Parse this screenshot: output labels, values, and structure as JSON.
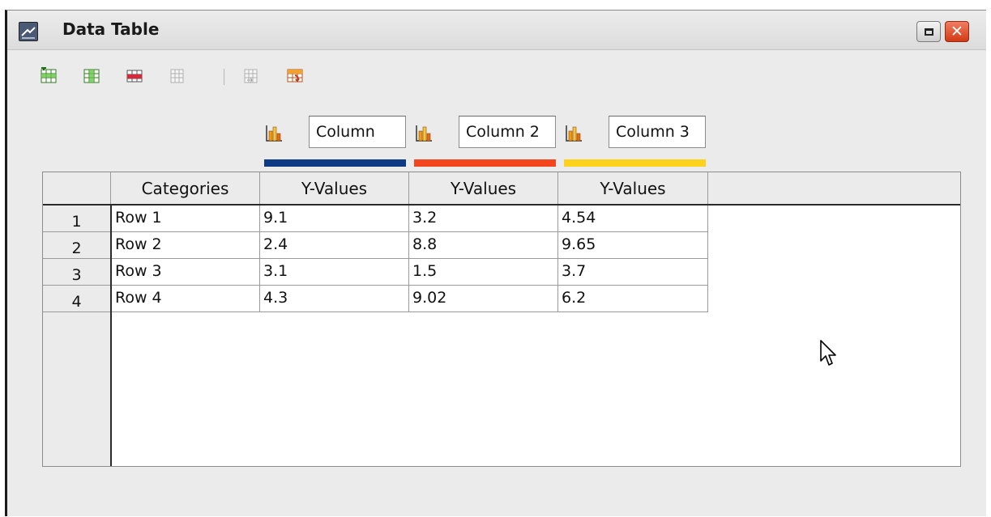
{
  "window": {
    "title": "Data Table",
    "controls": {
      "restore_icon": "restore-icon",
      "close_icon": "close-icon",
      "close_color": "#d9401c"
    }
  },
  "toolbar": {
    "buttons": [
      {
        "name": "insert-row-button",
        "icon": "insert-row-icon"
      },
      {
        "name": "insert-series-button",
        "icon": "insert-series-icon"
      },
      {
        "name": "delete-row-button",
        "icon": "delete-row-icon"
      },
      {
        "name": "delete-series-button",
        "icon": "delete-series-icon"
      },
      {
        "name": "move-series-right-button",
        "icon": "move-series-right-icon"
      },
      {
        "name": "move-row-down-button",
        "icon": "move-row-down-icon"
      }
    ]
  },
  "series": [
    {
      "name": "Column",
      "color": "#0e3b84"
    },
    {
      "name": "Column 2",
      "color": "#f4461e"
    },
    {
      "name": "Column 3",
      "color": "#fdd21c"
    }
  ],
  "table": {
    "headers": [
      "Categories",
      "Y-Values",
      "Y-Values",
      "Y-Values"
    ],
    "rows": [
      {
        "num": "1",
        "cells": [
          "Row 1",
          "9.1",
          "3.2",
          "4.54"
        ]
      },
      {
        "num": "2",
        "cells": [
          "Row 2",
          "2.4",
          "8.8",
          "9.65"
        ]
      },
      {
        "num": "3",
        "cells": [
          "Row 3",
          "3.1",
          "1.5",
          "3.7"
        ]
      },
      {
        "num": "4",
        "cells": [
          "Row 4",
          "4.3",
          "9.02",
          "6.2"
        ]
      }
    ]
  }
}
